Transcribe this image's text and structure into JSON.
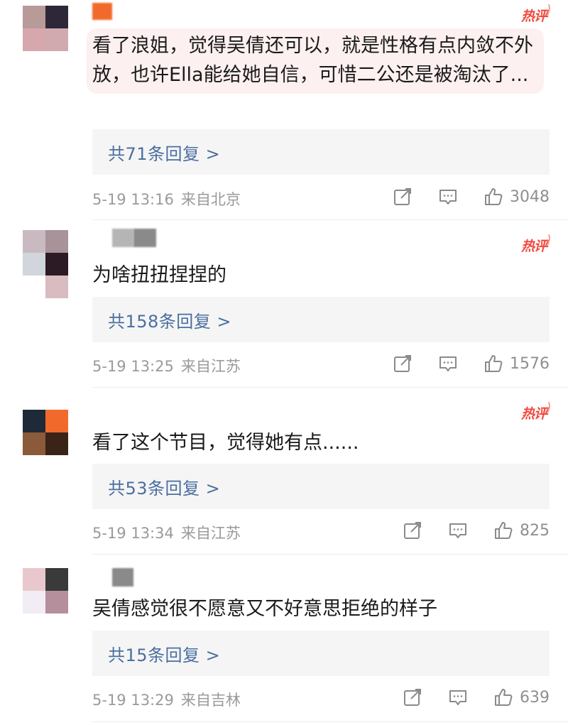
{
  "hot_label": "热评",
  "comments": [
    {
      "username": "",
      "text": "看了浪姐，觉得吴倩还可以，就是性格有点内敛不外放，也许Ella能给她自信，可惜二公还是被淘汰了...",
      "highlighted": true,
      "reply_label": "共71条回复 >",
      "date": "5-19 13:16",
      "location": "来自北京",
      "likes": "3048",
      "avatar_colors": [
        "#b89a98",
        "#2d2738",
        "#d7a7ae",
        "#d1aab0"
      ]
    },
    {
      "username": "",
      "text": "为啥扭扭捏捏的",
      "highlighted": false,
      "reply_label": "共158条回复 >",
      "date": "5-19 13:25",
      "location": "来自江苏",
      "likes": "1576",
      "avatar_colors": [
        "#c9bac1",
        "#a8939b",
        "#d0d6dc",
        "#2c1a24",
        "#ffffff",
        "#d9bcc0"
      ]
    },
    {
      "username": "",
      "text": "看了这个节目，觉得她有点......",
      "highlighted": false,
      "reply_label": "共53条回复 >",
      "date": "5-19 13:34",
      "location": "来自江苏",
      "likes": "825",
      "avatar_colors": [
        "#1f2a38",
        "#f26a2b",
        "#8b5a3a",
        "#3a2418"
      ]
    },
    {
      "username": "",
      "text": "吴倩感觉很不愿意又不好意思拒绝的样子",
      "highlighted": false,
      "reply_label": "共15条回复 >",
      "date": "5-19 13:29",
      "location": "来自吉林",
      "likes": "639",
      "avatar_colors": [
        "#e8c8cc",
        "#3a3a3a",
        "#f2ecf4",
        "#b58f9c"
      ]
    }
  ],
  "icons": {
    "share": "share-icon",
    "comment": "comment-icon",
    "like": "thumbs-up-icon"
  }
}
